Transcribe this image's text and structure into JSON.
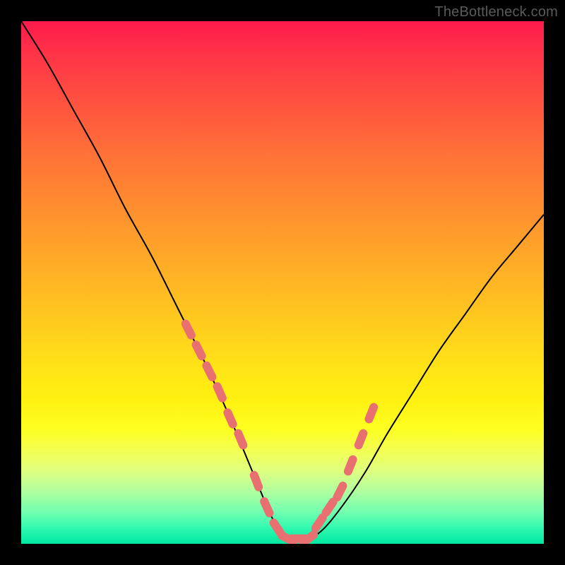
{
  "watermark": "TheBottleneck.com",
  "chart_data": {
    "type": "line",
    "title": "",
    "xlabel": "",
    "ylabel": "",
    "ylim": [
      0,
      100
    ],
    "xlim": [
      0,
      100
    ],
    "series": [
      {
        "name": "bottleneck-curve",
        "x": [
          0,
          5,
          10,
          15,
          20,
          25,
          30,
          35,
          40,
          45,
          48,
          50,
          52,
          55,
          58,
          62,
          66,
          70,
          75,
          80,
          85,
          90,
          95,
          100
        ],
        "values": [
          100,
          92,
          83,
          74,
          64,
          55,
          45,
          35,
          24,
          12,
          5,
          2,
          1,
          1,
          3,
          8,
          14,
          21,
          29,
          37,
          44,
          51,
          57,
          63
        ]
      }
    ],
    "markers": {
      "name": "highlight-dots",
      "x": [
        32,
        34,
        36,
        38,
        40,
        42,
        45,
        47,
        49,
        51,
        53,
        55,
        57,
        59,
        61,
        63,
        65,
        67
      ],
      "values": [
        41,
        37,
        33,
        29,
        24,
        20,
        12,
        7,
        3,
        1,
        1,
        1,
        4,
        7,
        10,
        15,
        20,
        25
      ]
    }
  }
}
